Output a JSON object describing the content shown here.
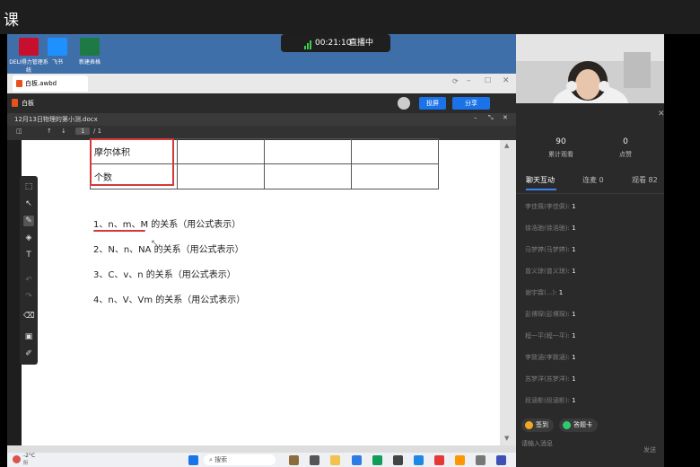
{
  "header": {
    "title": "课"
  },
  "desktop": {
    "icons": [
      "DELI得力管理系统",
      "飞书",
      "新建表格"
    ]
  },
  "live": {
    "time": "00:21:10",
    "status": "直播中"
  },
  "app": {
    "tab_title": "白板.awbd",
    "toolbar_label": "白板",
    "btn_share_screen": "投屏",
    "btn_share": "分享"
  },
  "doc": {
    "title": "12月13日物理的第小测.docx",
    "page": "1",
    "page_total": "/ 1",
    "table_rows": [
      [
        "摩尔体积",
        "",
        "",
        ""
      ],
      [
        "个数",
        "",
        "",
        ""
      ]
    ],
    "questions": [
      "1、n、m、M 的关系（用公式表示）",
      "2、N、n、NA 的关系（用公式表示）",
      "3、C、v、n 的关系（用公式表示）",
      "4、n、V、Vm 的关系（用公式表示）"
    ]
  },
  "stats": {
    "views": "90",
    "views_label": "累计观看",
    "likes": "0",
    "likes_label": "点赞"
  },
  "tabs": {
    "chat": "聊天互动",
    "mic": "连麦 0",
    "viewers": "观看 82"
  },
  "messages": [
    {
      "name": "李佳佩(李佳佩):",
      "text": "1"
    },
    {
      "name": "徐浩驰(徐浩驰):",
      "text": "1"
    },
    {
      "name": "马梦婷(马梦婷):",
      "text": "1"
    },
    {
      "name": "曾义琼(曾义琼):",
      "text": "1"
    },
    {
      "name": "谢宇霖(...):",
      "text": "1"
    },
    {
      "name": "彭博琛(彭博琛):",
      "text": "1"
    },
    {
      "name": "程一平(程一平):",
      "text": "1"
    },
    {
      "name": "李致涵(李致涵):",
      "text": "1"
    },
    {
      "name": "苏梦洋(苏梦洋):",
      "text": "1"
    },
    {
      "name": "段涵影(段涵影):",
      "text": "1"
    }
  ],
  "actions": {
    "signin": "签到",
    "answer": "答题卡"
  },
  "input": {
    "placeholder": "请输入消息",
    "send": "发送"
  },
  "taskbar": {
    "weather": "-2°C",
    "weather_sub": "阴",
    "search": "搜索"
  }
}
